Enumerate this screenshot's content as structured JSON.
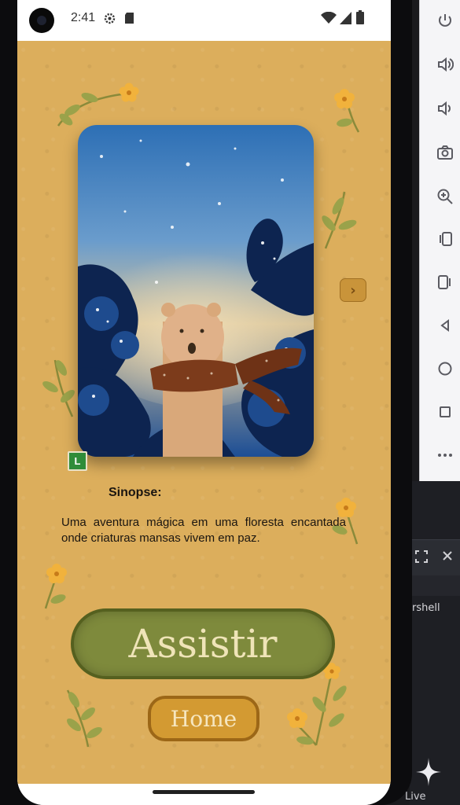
{
  "status_bar": {
    "time": "2:41",
    "icons": [
      "settings-gear-icon",
      "sd-card-icon",
      "wifi-icon",
      "signal-icon",
      "battery-icon"
    ]
  },
  "movie": {
    "rating": "L",
    "synopsis_label": "Sinopse:",
    "synopsis_text": "Uma aventura mágica em uma floresta encantada onde criaturas mansas vivem em paz."
  },
  "actions": {
    "watch_label": "Assistir",
    "home_label": "Home",
    "next_icon": "chevron-right-icon"
  },
  "emulator": {
    "controls": [
      "power-icon",
      "volume-up-icon",
      "volume-down-icon",
      "camera-icon",
      "zoom-in-icon",
      "rotate-left-icon",
      "rotate-right-icon",
      "back-icon",
      "home-icon",
      "overview-icon",
      "more-icon"
    ],
    "terminal_label": "rshell",
    "footer_label": "Live"
  },
  "colors": {
    "background": "#dcae5c",
    "watch_button": "#7e8a3c",
    "home_button": "#d39a32",
    "rating_badge": "#2f8c39"
  }
}
